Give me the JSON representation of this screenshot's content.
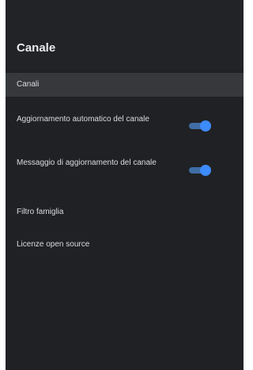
{
  "settings": {
    "title": "Canale",
    "items": [
      {
        "label": "Canali",
        "selected": true
      },
      {
        "label": "Aggiornamento automatico del canale",
        "toggle": true,
        "state": "on"
      },
      {
        "label": "Messaggio di aggiornamento del canale",
        "toggle": true,
        "state": "on"
      },
      {
        "label": "Filtro famiglia"
      },
      {
        "label": "Licenze open source"
      }
    ]
  },
  "colors": {
    "background": "#202124",
    "selected_row": "#36383c",
    "toggle_track": "#3f6da4",
    "toggle_thumb": "#3d8bfd",
    "text": "#dadce0"
  },
  "icons": [
    "toggle-switch-icon"
  ]
}
